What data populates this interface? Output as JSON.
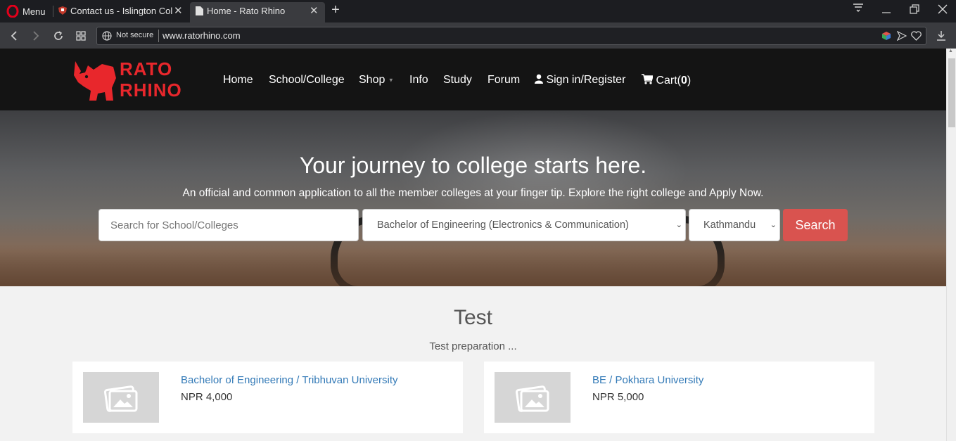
{
  "browser": {
    "menu_label": "Menu",
    "tabs": [
      {
        "label": "Contact us - Islington Colle"
      },
      {
        "label": "Home - Rato Rhino"
      }
    ],
    "new_tab_label": "+",
    "security_label": "Not secure",
    "url": "www.ratorhino.com",
    "icons": [
      "opera-logo-icon",
      "back-icon",
      "forward-icon",
      "reload-icon",
      "speed-dial-icon",
      "globe-icon",
      "extension-cube-icon",
      "send-icon",
      "heart-icon",
      "download-icon",
      "tab-menu-icon",
      "minimize-icon",
      "restore-icon",
      "close-icon"
    ]
  },
  "site": {
    "logo_line1": "RATO",
    "logo_line2": "RHINO",
    "nav": {
      "home": "Home",
      "school": "School/College",
      "shop": "Shop",
      "info": "Info",
      "study": "Study",
      "forum": "Forum",
      "signin": "Sign in/Register",
      "cart_label": "Cart(",
      "cart_count": "0",
      "cart_close": ")"
    },
    "hero": {
      "title": "Your journey to college starts here.",
      "subtitle": "An official and common application to all the member colleges at your finger tip. Explore the right college and Apply Now.",
      "search_placeholder": "Search for School/Colleges",
      "program_selected": "Bachelor of Engineering (Electronics & Communication)",
      "location_selected": "Kathmandu",
      "search_button": "Search"
    },
    "section": {
      "title": "Test",
      "subtitle": "Test preparation ..."
    },
    "cards": [
      {
        "title": "Bachelor of Engineering / Tribhuvan University",
        "price": "NPR 4,000"
      },
      {
        "title": "BE / Pokhara University",
        "price": "NPR 5,000"
      }
    ]
  },
  "colors": {
    "brand_red": "#e8272c",
    "search_button": "#d9534f",
    "link_blue": "#337ab7",
    "navbar": "#141414"
  }
}
